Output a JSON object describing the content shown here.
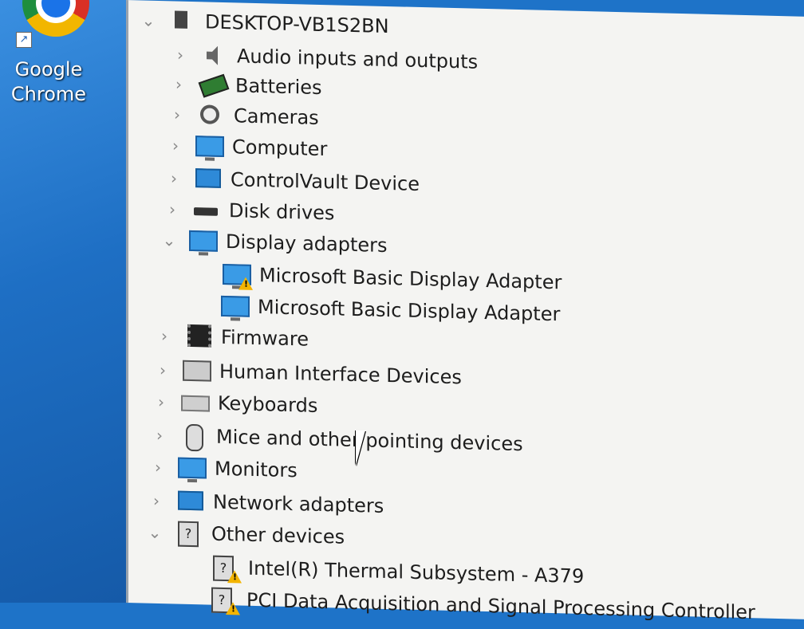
{
  "desktop": {
    "icons": [
      {
        "label_line1": "Google",
        "label_line2": "Chrome",
        "icon": "chrome-icon"
      }
    ]
  },
  "tree": {
    "root": {
      "label": "DESKTOP-VB1S2BN",
      "icon": "computer-icon",
      "expanded": true
    },
    "items": [
      {
        "label": "Audio inputs and outputs",
        "icon": "speaker-icon",
        "expanded": false
      },
      {
        "label": "Batteries",
        "icon": "battery-icon",
        "expanded": false
      },
      {
        "label": "Cameras",
        "icon": "camera-icon",
        "expanded": false
      },
      {
        "label": "Computer",
        "icon": "monitor-icon",
        "expanded": false
      },
      {
        "label": "ControlVault Device",
        "icon": "network-monitor-icon",
        "expanded": false
      },
      {
        "label": "Disk drives",
        "icon": "disk-icon",
        "expanded": false
      },
      {
        "label": "Display adapters",
        "icon": "display-adapter-icon",
        "expanded": true,
        "children": [
          {
            "label": "Microsoft Basic Display Adapter",
            "icon": "display-adapter-warning-icon",
            "warning": true
          },
          {
            "label": "Microsoft Basic Display Adapter",
            "icon": "display-adapter-icon",
            "warning": false
          }
        ]
      },
      {
        "label": "Firmware",
        "icon": "chip-icon",
        "expanded": false
      },
      {
        "label": "Human Interface Devices",
        "icon": "hid-icon",
        "expanded": false
      },
      {
        "label": "Keyboards",
        "icon": "keyboard-icon",
        "expanded": false
      },
      {
        "label": "Mice and other pointing devices",
        "icon": "mouse-icon",
        "expanded": false
      },
      {
        "label": "Monitors",
        "icon": "monitor-icon",
        "expanded": false
      },
      {
        "label": "Network adapters",
        "icon": "network-adapter-icon",
        "expanded": false
      },
      {
        "label": "Other devices",
        "icon": "unknown-device-icon",
        "expanded": true,
        "children": [
          {
            "label": "Intel(R) Thermal Subsystem - A379",
            "icon": "unknown-device-warning-icon",
            "warning": true
          },
          {
            "label": "PCI Data Acquisition and Signal Processing Controller",
            "icon": "unknown-device-warning-icon",
            "warning": true
          }
        ]
      }
    ]
  },
  "colors": {
    "desktop_bg": "#1e73c8",
    "panel_bg": "#f4f4f2",
    "warning": "#f3b400"
  }
}
